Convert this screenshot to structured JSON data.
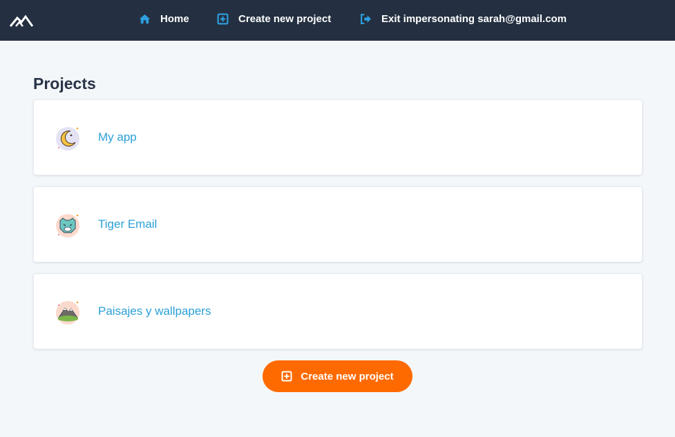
{
  "nav": {
    "home": {
      "label": "Home",
      "icon": "home-icon"
    },
    "create": {
      "label": "Create new project",
      "icon": "plus-square-icon"
    },
    "exit": {
      "label": "Exit impersonating sarah@gmail.com",
      "icon": "sign-out-icon"
    }
  },
  "page": {
    "title": "Projects"
  },
  "projects": [
    {
      "name": "My app",
      "icon": "moon-icon"
    },
    {
      "name": "Tiger Email",
      "icon": "tiger-icon"
    },
    {
      "name": "Paisajes y wallpapers",
      "icon": "mountain-icon"
    }
  ],
  "create_button": {
    "label": "Create new project",
    "icon": "plus-square-icon"
  },
  "colors": {
    "topbar": "#243041",
    "accent_blue": "#2a9fd8",
    "button_orange": "#ff6a00",
    "background": "#f4f7fa"
  }
}
